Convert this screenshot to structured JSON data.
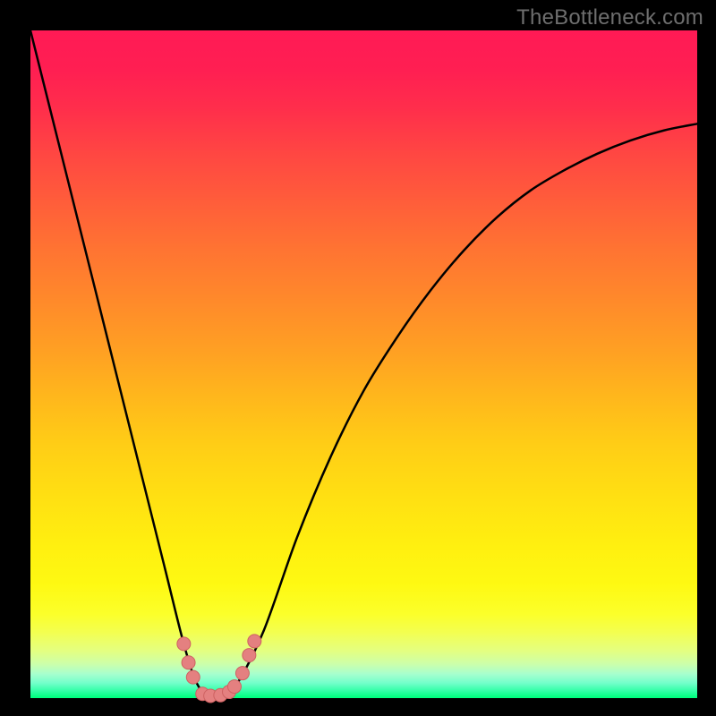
{
  "watermark": "TheBottleneck.com",
  "chart_data": {
    "type": "line",
    "title": "",
    "xlabel": "",
    "ylabel": "",
    "ylim": [
      0,
      100
    ],
    "xlim": [
      0,
      100
    ],
    "x": [
      0,
      5,
      10,
      15,
      20,
      23,
      25,
      27,
      29,
      31,
      35,
      40,
      45,
      50,
      55,
      60,
      65,
      70,
      75,
      80,
      85,
      90,
      95,
      100
    ],
    "series": [
      {
        "name": "bottleneck-curve",
        "values": [
          100,
          80,
          60,
          40,
          20,
          8,
          2,
          0,
          0,
          2,
          10,
          24,
          36,
          46,
          54,
          61,
          67,
          72,
          76,
          79,
          81.5,
          83.5,
          85,
          86
        ]
      }
    ],
    "markers": [
      {
        "x": 23.0,
        "y": 8.0
      },
      {
        "x": 23.7,
        "y": 5.2
      },
      {
        "x": 24.4,
        "y": 3.0
      },
      {
        "x": 25.8,
        "y": 0.5
      },
      {
        "x": 27.0,
        "y": 0.2
      },
      {
        "x": 28.5,
        "y": 0.3
      },
      {
        "x": 29.8,
        "y": 0.8
      },
      {
        "x": 30.6,
        "y": 1.6
      },
      {
        "x": 31.8,
        "y": 3.6
      },
      {
        "x": 32.8,
        "y": 6.3
      },
      {
        "x": 33.6,
        "y": 8.4
      }
    ],
    "gradient_stops": [
      {
        "pos": 0.0,
        "color": "#ff1a55"
      },
      {
        "pos": 0.06,
        "color": "#ff1f52"
      },
      {
        "pos": 0.12,
        "color": "#ff2f4b"
      },
      {
        "pos": 0.18,
        "color": "#ff4543"
      },
      {
        "pos": 0.25,
        "color": "#ff5b3b"
      },
      {
        "pos": 0.32,
        "color": "#ff7133"
      },
      {
        "pos": 0.4,
        "color": "#ff882b"
      },
      {
        "pos": 0.48,
        "color": "#ffa023"
      },
      {
        "pos": 0.55,
        "color": "#ffb71c"
      },
      {
        "pos": 0.62,
        "color": "#ffcd16"
      },
      {
        "pos": 0.7,
        "color": "#ffe012"
      },
      {
        "pos": 0.77,
        "color": "#ffef10"
      },
      {
        "pos": 0.83,
        "color": "#fef912"
      },
      {
        "pos": 0.875,
        "color": "#fbff2a"
      },
      {
        "pos": 0.905,
        "color": "#f2ff55"
      },
      {
        "pos": 0.93,
        "color": "#e4ff80"
      },
      {
        "pos": 0.95,
        "color": "#ccffab"
      },
      {
        "pos": 0.965,
        "color": "#a7ffce"
      },
      {
        "pos": 0.978,
        "color": "#74ffcb"
      },
      {
        "pos": 0.99,
        "color": "#32ffa7"
      },
      {
        "pos": 1.0,
        "color": "#00ff80"
      }
    ]
  }
}
